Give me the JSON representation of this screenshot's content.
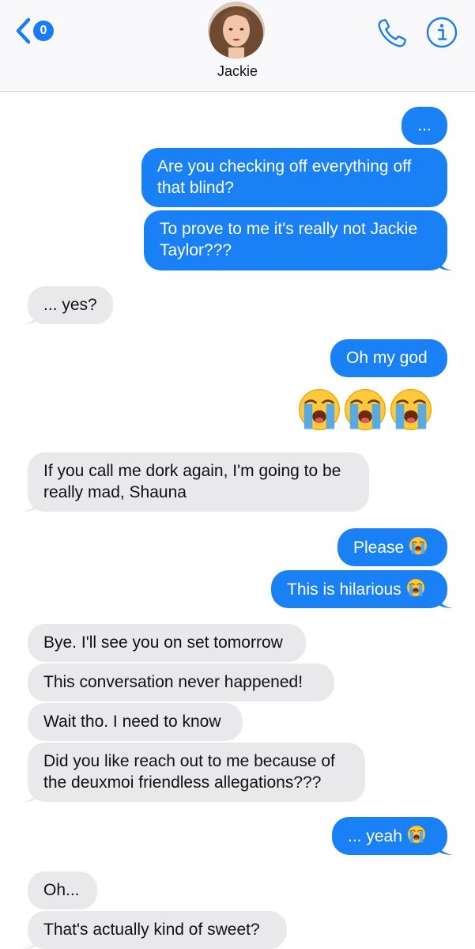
{
  "header": {
    "back_badge_count": "0",
    "contact_name": "Jackie",
    "back_icon": "chevron-left-icon",
    "call_icon": "phone-icon",
    "info_icon": "info-icon"
  },
  "colors": {
    "outgoing_bubble": "#1a80f5",
    "incoming_bubble": "#e9e9eb",
    "accent": "#1a7cf5"
  },
  "messages": [
    {
      "dir": "out",
      "text": "..."
    },
    {
      "dir": "out",
      "lines": [
        "Are you checking off everything off",
        "that blind?"
      ]
    },
    {
      "dir": "out",
      "lines": [
        "To prove to me it's really not Jackie",
        "Taylor???"
      ]
    },
    {
      "dir": "in",
      "text": "... yes?"
    },
    {
      "dir": "out",
      "text": "Oh my god"
    },
    {
      "dir": "out",
      "emoji": [
        "loudly-crying-face",
        "loudly-crying-face",
        "loudly-crying-face"
      ]
    },
    {
      "dir": "in",
      "lines": [
        "If you call me dork again, I'm going to be",
        "really mad, Shauna"
      ]
    },
    {
      "dir": "out",
      "text": "Please",
      "emoji": "loudly-crying-face"
    },
    {
      "dir": "out",
      "text": "This is hilarious",
      "emoji": "loudly-crying-face"
    },
    {
      "dir": "in",
      "text": "Bye. I'll see you on set tomorrow"
    },
    {
      "dir": "in",
      "text": "This conversation never happened!"
    },
    {
      "dir": "in",
      "text": "Wait tho. I need to know"
    },
    {
      "dir": "in",
      "lines": [
        "Did you like reach out to me because of",
        "the deuxmoi friendless allegations???"
      ]
    },
    {
      "dir": "out",
      "text": "... yeah",
      "emoji": "loudly-crying-face"
    },
    {
      "dir": "in",
      "text": "Oh..."
    },
    {
      "dir": "in",
      "text": "That's actually kind of sweet?"
    }
  ]
}
